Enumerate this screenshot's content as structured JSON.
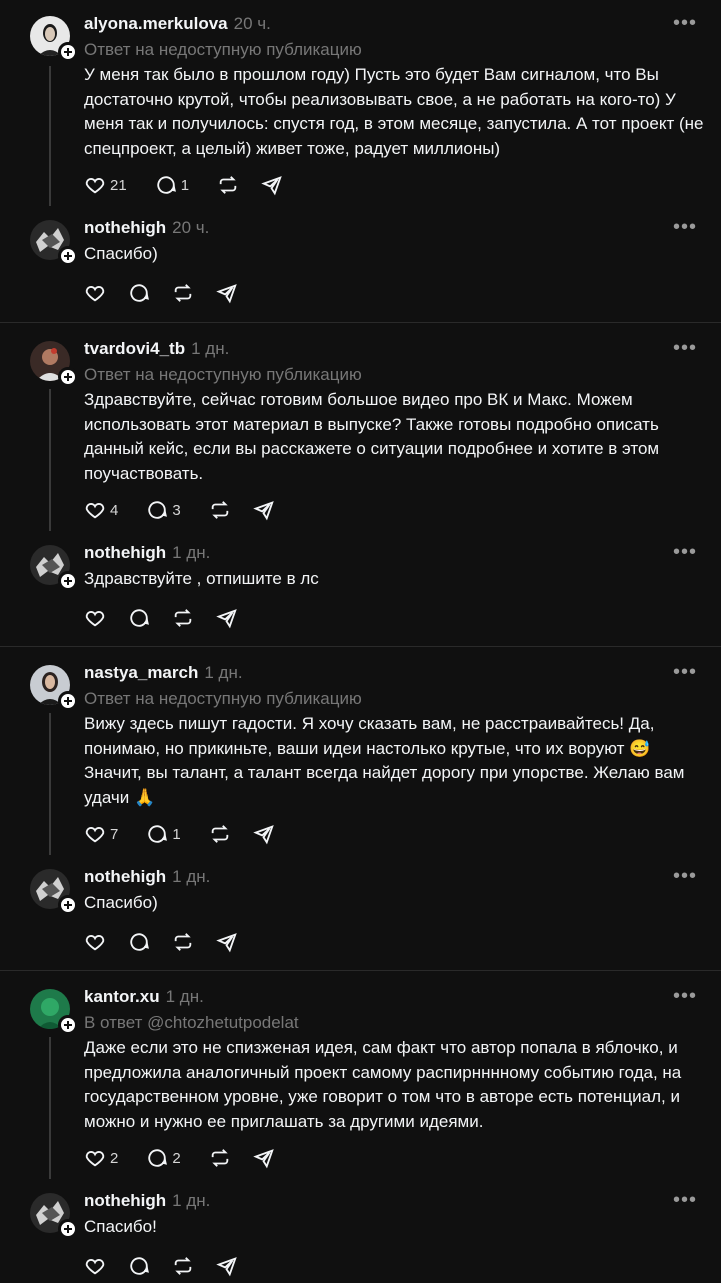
{
  "threads": [
    {
      "comment": {
        "username": "alyona.merkulova",
        "time": "20 ч.",
        "reply_to": "Ответ на недоступную публикацию",
        "text": "У меня так было в прошлом году) Пусть это будет Вам сигналом, что Вы достаточно крутой, чтобы реализовывать свое, а не работать на кого-то) У меня так и получилось: спустя год, в этом месяце, запустила. А тот проект (не спецпроект, а целый) живет тоже, радует миллионы)",
        "likes": "21",
        "replies": "1"
      },
      "reply": {
        "username": "nothehigh",
        "time": "20 ч.",
        "text": "Спасибо)"
      }
    },
    {
      "comment": {
        "username": "tvardovi4_tb",
        "time": "1 дн.",
        "reply_to": "Ответ на недоступную публикацию",
        "text": "Здравствуйте, сейчас готовим большое видео про ВК и Макс. Можем использовать этот материал в выпуске? Также готовы подробно описать данный кейс, если вы расскажете о ситуации подробнее и хотите в этом поучаствовать.",
        "likes": "4",
        "replies": "3"
      },
      "reply": {
        "username": "nothehigh",
        "time": "1 дн.",
        "text": "Здравствуйте , отпишите в лс"
      }
    },
    {
      "comment": {
        "username": "nastya_march",
        "time": "1 дн.",
        "reply_to": "Ответ на недоступную публикацию",
        "text": "Вижу здесь пишут гадости. Я хочу сказать вам, не расстраивайтесь! Да, понимаю, но прикиньте, ваши идеи настолько крутые, что их воруют 😅 Значит, вы талант, а талант всегда найдет дорогу при упорстве. Желаю вам удачи 🙏",
        "likes": "7",
        "replies": "1"
      },
      "reply": {
        "username": "nothehigh",
        "time": "1 дн.",
        "text": "Спасибо)"
      }
    },
    {
      "comment": {
        "username": "kantor.xu",
        "time": "1 дн.",
        "reply_to": "В ответ @chtozhetutpodelat",
        "text": "Даже если это не спизженая идея, сам факт что автор попала в яблочко, и предложила аналогичный проект самому распирнннному событию года, на государственном уровне, уже говорит о том что в авторе есть потенциал, и можно и нужно ее приглашать за другими идеями.",
        "likes": "2",
        "replies": "2"
      },
      "reply": {
        "username": "nothehigh",
        "time": "1 дн.",
        "text": "Спасибо!"
      }
    }
  ],
  "more_label": "•••",
  "icons": [
    "heart-icon",
    "comment-icon",
    "repost-icon",
    "share-icon"
  ]
}
